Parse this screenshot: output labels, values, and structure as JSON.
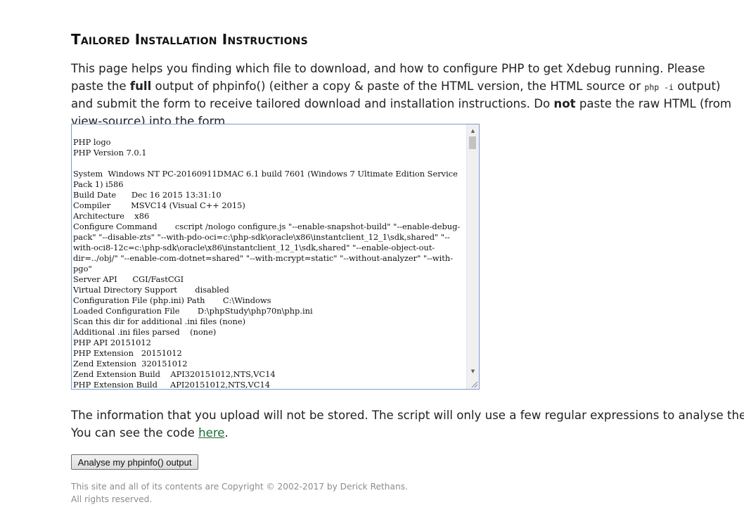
{
  "page": {
    "top_cut_text": "prior paragraph text (cut off at top edge)"
  },
  "heading": "Tailored Installation Instructions",
  "intro": {
    "part1": "This page helps you finding which file to download, and how to configure PHP to get Xdebug running. Please paste the ",
    "bold1": "full",
    "part2": " output of phpinfo() (either a copy & paste of the HTML version, the HTML source or ",
    "code": "php -i",
    "part3": " output) and submit the form to receive tailored download and installation instructions. Do ",
    "bold2": "not",
    "part4": " paste the raw HTML (from view-source) into the form."
  },
  "phpinfo_textarea": {
    "value": "PHP logo\nPHP Version 7.0.1\n\nSystem  Windows NT PC-20160911DMAC 6.1 build 7601 (Windows 7 Ultimate Edition Service Pack 1) i586\nBuild Date      Dec 16 2015 13:31:10\nCompiler        MSVC14 (Visual C++ 2015)\nArchitecture    x86\nConfigure Command       cscript /nologo configure.js \"--enable-snapshot-build\" \"--enable-debug-pack\" \"--disable-zts\" \"--with-pdo-oci=c:\\php-sdk\\oracle\\x86\\instantclient_12_1\\sdk,shared\" \"--with-oci8-12c=c:\\php-sdk\\oracle\\x86\\instantclient_12_1\\sdk,shared\" \"--enable-object-out-dir=../obj/\" \"--enable-com-dotnet=shared\" \"--with-mcrypt=static\" \"--without-analyzer\" \"--with-pgo\"\nServer API      CGI/FastCGI\nVirtual Directory Support       disabled\nConfiguration File (php.ini) Path       C:\\Windows\nLoaded Configuration File       D:\\phpStudy\\php70n\\php.ini\nScan this dir for additional .ini files (none)\nAdditional .ini files parsed    (none)\nPHP API 20151012\nPHP Extension   20151012\nZend Extension  320151012\nZend Extension Build    API320151012,NTS,VC14\nPHP Extension Build     API20151012,NTS,VC14"
  },
  "info": {
    "line1": "The information that you upload will not be stored. The script will only use a few regular expressions to analyse the output and",
    "line2_prefix": "You can see the code ",
    "link": "here",
    "line2_suffix": "."
  },
  "submit_label": "Analyse my phpinfo() output",
  "footer": {
    "line1": "This site and all of its contents are Copyright © 2002-2017 by Derick Rethans.",
    "line2": "All rights reserved."
  },
  "icons": {
    "scroll_up": "triangle-up",
    "scroll_down": "triangle-down",
    "resize": "resize-grip"
  },
  "colors": {
    "link": "#1e6b34",
    "textarea_border": "#7a9cd3",
    "footer_text": "#8c8c8c"
  }
}
